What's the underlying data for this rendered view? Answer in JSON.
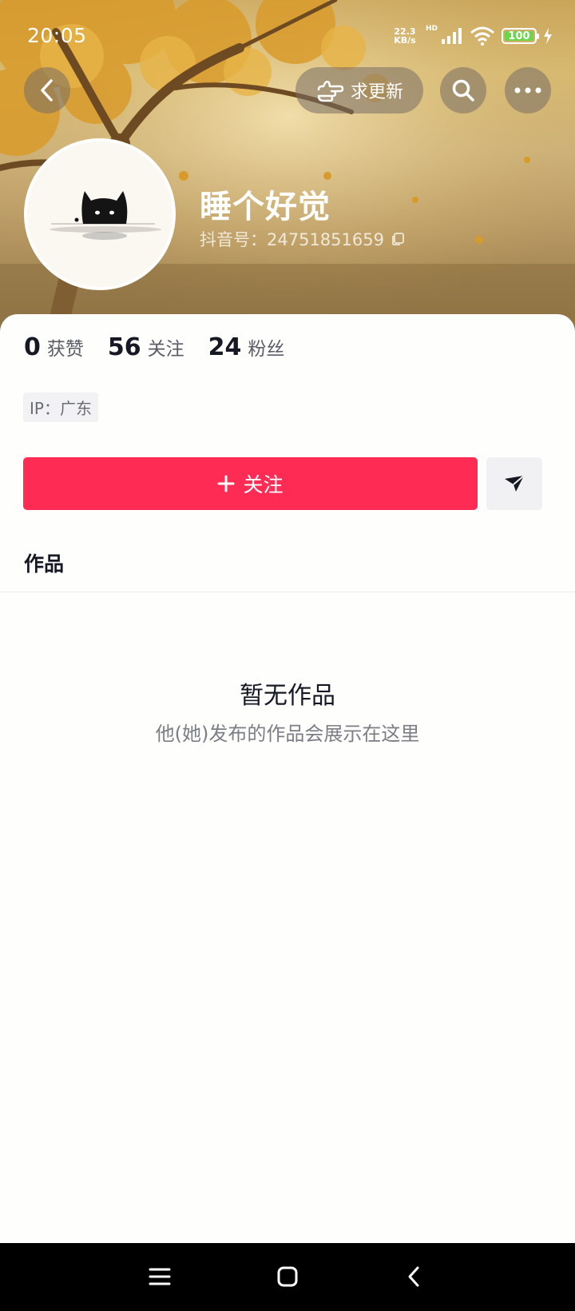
{
  "status": {
    "time": "20:05",
    "speed_value": "22.3",
    "speed_unit": "KB/s",
    "hd": "HD",
    "battery": "100"
  },
  "header": {
    "update_label": "求更新",
    "icons": {
      "back": "chevron-left-icon",
      "search": "search-icon",
      "more": "more-dots-icon",
      "hand": "hand-pointer-icon"
    }
  },
  "profile": {
    "name": "睡个好觉",
    "id_label": "抖音号：24751851659",
    "copy_icon": "copy-icon"
  },
  "stats": [
    {
      "value": "0",
      "label": "获赞"
    },
    {
      "value": "56",
      "label": "关注"
    },
    {
      "value": "24",
      "label": "粉丝"
    }
  ],
  "ip_location": "IP：广东",
  "actions": {
    "follow_label": "关注",
    "follow_icon": "plus-icon",
    "share_icon": "send-icon"
  },
  "tabs": {
    "works": "作品"
  },
  "empty_state": {
    "title": "暂无作品",
    "subtitle": "他(她)发布的作品会展示在这里"
  },
  "colors": {
    "accent": "#fe2c55",
    "text_primary": "#161823",
    "text_secondary": "#7c7e86"
  }
}
